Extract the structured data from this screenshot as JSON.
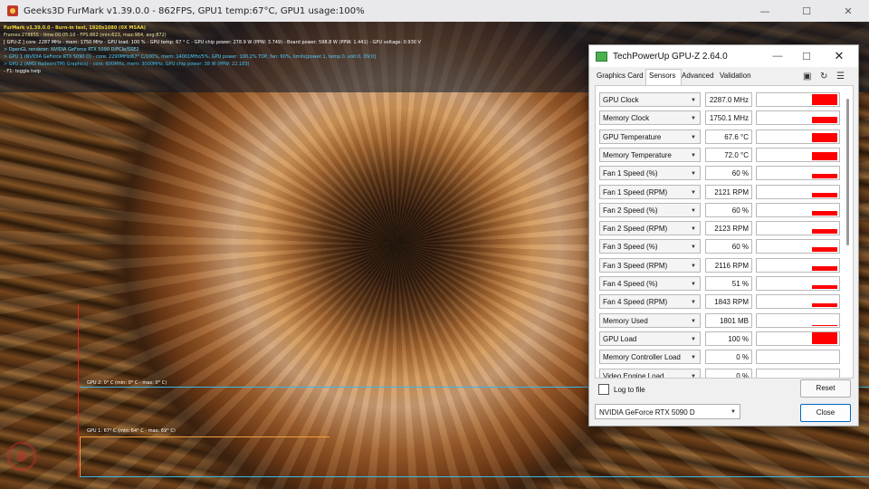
{
  "furmark": {
    "title": "Geeks3D FurMark v1.39.0.0 - 862FPS, GPU1 temp:67°C, GPU1 usage:100%",
    "osd": [
      "FurMark v1.39.0.0 - Burn-in test, 1920x1080 (0X MSAA)",
      "Frames:278855 - time:00:05:10 - FPS:862 (min:623, max:984, avg:872)",
      "[ GPU-Z ] core: 2287 MHz - mem: 1750 MHz - GPU load: 100 % - GPU temp: 67 ° C - GPU chip power: 278.9 W (PPW: 3.749) - Board power: 598.8 W (PPW: 1.441) - GPU voltage: 0.930 V",
      "> OpenGL renderer: NVIDIA GeForce RTX 5090 D/PCIe/SSE2",
      "> GPU 1 (NVIDIA GeForce RTX 5090 D) - core: 2290MHz/67° C/100%, mem: 14001MHz/5%, GPU power: 100.2% TDP, fan: 60%, limits[power:1, temp:0, volt:0, OV:0]",
      "> GPU 2 (AMD Radeon(TM) Graphics) - core: 600MHz, mem: 3000MHz, GPU chip power: 38 W (PPW: 22.183)",
      "- F1: toggle help"
    ],
    "graph_labels": {
      "gpu2": "GPU 2: 0° C (min: 0° C - max: 0° C)",
      "gpu1": "GPU 1: 67° C (min: 64° C - max: 69° C)"
    },
    "window_controls": {
      "minimize": "—",
      "maximize": "☐",
      "close": "✕"
    }
  },
  "gpuz": {
    "title": "TechPowerUp GPU-Z 2.64.0",
    "window_controls": {
      "minimize": "—",
      "maximize": "☐",
      "close": "✕"
    },
    "tabs": [
      "Graphics Card",
      "Sensors",
      "Advanced",
      "Validation"
    ],
    "active_tab": "Sensors",
    "toolbar_icons": [
      "camera-icon",
      "refresh-icon",
      "menu-icon"
    ],
    "sensors": [
      {
        "name": "GPU Clock",
        "value": "2287.0 MHz",
        "level": 0.95
      },
      {
        "name": "Memory Clock",
        "value": "1750.1 MHz",
        "level": 0.55
      },
      {
        "name": "GPU Temperature",
        "value": "67.6 °C",
        "level": 0.75
      },
      {
        "name": "Memory Temperature",
        "value": "72.0 °C",
        "level": 0.7
      },
      {
        "name": "Fan 1 Speed (%)",
        "value": "60 %",
        "level": 0.35
      },
      {
        "name": "Fan 1 Speed (RPM)",
        "value": "2121 RPM",
        "level": 0.35
      },
      {
        "name": "Fan 2 Speed (%)",
        "value": "60 %",
        "level": 0.35
      },
      {
        "name": "Fan 2 Speed (RPM)",
        "value": "2123 RPM",
        "level": 0.35
      },
      {
        "name": "Fan 3 Speed (%)",
        "value": "60 %",
        "level": 0.35
      },
      {
        "name": "Fan 3 Speed (RPM)",
        "value": "2116 RPM",
        "level": 0.35
      },
      {
        "name": "Fan 4 Speed (%)",
        "value": "51 %",
        "level": 0.3
      },
      {
        "name": "Fan 4 Speed (RPM)",
        "value": "1843 RPM",
        "level": 0.3
      },
      {
        "name": "Memory Used",
        "value": "1801 MB",
        "level": 0.06
      },
      {
        "name": "GPU Load",
        "value": "100 %",
        "level": 1.0
      },
      {
        "name": "Memory Controller Load",
        "value": "0 %",
        "level": 0
      },
      {
        "name": "Video Engine Load",
        "value": "0 %",
        "level": 0
      }
    ],
    "log_to_file": {
      "label": "Log to file",
      "checked": false
    },
    "reset_label": "Reset",
    "gpu_selected": "NVIDIA GeForce RTX 5090 D",
    "close_label": "Close",
    "colors": {
      "graph_fill": "#ff0000",
      "close_border": "#0067c0"
    }
  }
}
